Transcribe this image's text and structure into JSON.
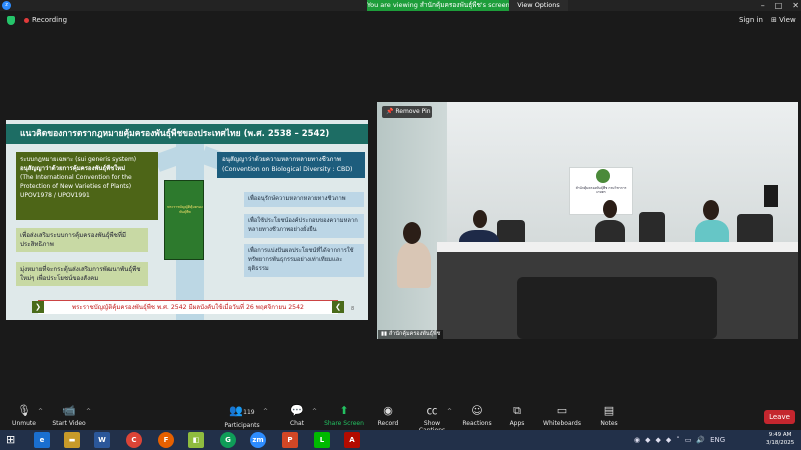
{
  "window": {
    "app_icon": "zoom",
    "share_banner": "You are viewing สำนักคุ้มครองพันธุ์พืช's screen",
    "view_options_label": "View Options",
    "controls": [
      "–",
      "□",
      "✕"
    ]
  },
  "header": {
    "recording_label": "Recording",
    "sign_in_label": "Sign in",
    "view_label": "View"
  },
  "slide": {
    "title": "แนวคิดของการตรากฎหมายคุ้มครองพันธุ์พืชของประเทศไทย (พ.ศ. 2538 – 2542)",
    "left_head": {
      "line1": "ระบบกฎหมายเฉพาะ (sui generis system)",
      "line2": "อนุสัญญาว่าด้วยการคุ้มครองพันธุ์พืชใหม่",
      "line3": "(The International Convention for the Protection of New Varieties of Plants)",
      "line4": "UPOV1978 / UPOV1991"
    },
    "left_items": [
      "เพื่อส่งเสริมระบบการคุ้มครองพันธุ์พืชที่มีประสิทธิภาพ",
      "มุ่งหมายที่จะกระตุ้นส่งเสริมการพัฒนาพันธุ์พืชใหม่ๆ เพื่อประโยชน์ของสังคม"
    ],
    "book_title": "พระราชบัญญัติคุ้มครองพันธุ์พืช",
    "right_head": {
      "line1": "อนุสัญญาว่าด้วยความหลากหลายทางชีวภาพ",
      "line2": "(Convention on Biological Diversity : CBD)"
    },
    "right_items": [
      "เพื่ออนุรักษ์ความหลากหลายทางชีวภาพ",
      "เพื่อใช้ประโยชน์องค์ประกอบของความหลากหลายทางชีวภาพอย่างยั่งยืน",
      "เพื่อการแบ่งปันผลประโยชน์ที่ได้จากการใช้ทรัพยากรพันธุกรรมอย่างเท่าเทียมและยุติธรรม"
    ],
    "footer": "พระราชบัญญัติคุ้มครองพันธุ์พืช พ.ศ. 2542 มีผลบังคับใช้เมื่อวันที่ 26 พฤศจิกายน 2542",
    "page_number": "8"
  },
  "video": {
    "remove_pin_label": "Remove Pin",
    "participant_name": "สำนักคุ้มครองพันธุ์พืช",
    "board_text": "สำนักคุ้มครองพันธุ์พืช กรมวิชาการเกษตร"
  },
  "toolbar": {
    "unmute_label": "Unmute",
    "start_video_label": "Start Video",
    "participants_label": "Participants",
    "participants_count": "119",
    "chat_label": "Chat",
    "share_label": "Share Screen",
    "record_label": "Record",
    "captions_label": "Show Captions",
    "reactions_label": "Reactions",
    "apps_label": "Apps",
    "whiteboards_label": "Whiteboards",
    "notes_label": "Notes",
    "leave_label": "Leave"
  },
  "taskbar": {
    "apps": [
      "e",
      "W",
      "C",
      "F",
      "G",
      "zm",
      "P",
      "L",
      "A"
    ],
    "tray_language": "ENG",
    "time": "9:49 AM",
    "date": "3/18/2025"
  },
  "colors": {
    "share_green": "#1d9d3a",
    "slide_title": "#1d6d64",
    "leave_red": "#c4262e",
    "taskbar": "#223049"
  }
}
